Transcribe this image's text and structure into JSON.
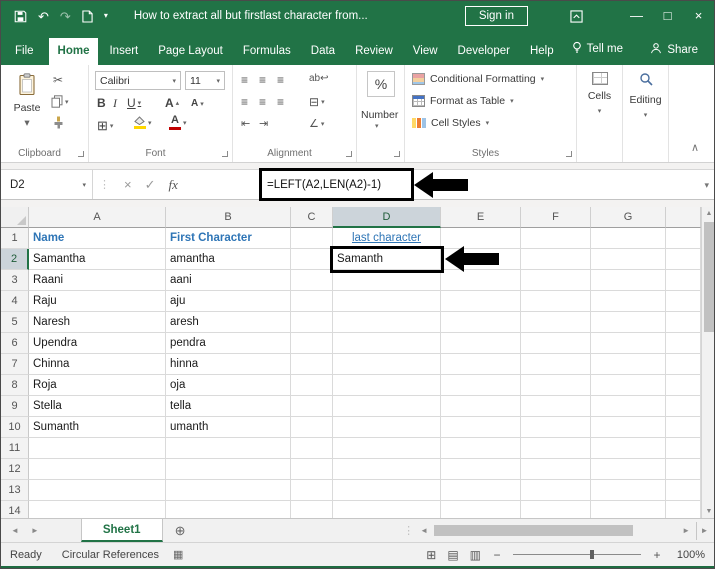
{
  "title_bar": {
    "title": "How to extract all but firstlast character from...",
    "sign_in": "Sign in"
  },
  "ribbon_tabs": [
    {
      "label": "File"
    },
    {
      "label": "Home"
    },
    {
      "label": "Insert"
    },
    {
      "label": "Page Layout"
    },
    {
      "label": "Formulas"
    },
    {
      "label": "Data"
    },
    {
      "label": "Review"
    },
    {
      "label": "View"
    },
    {
      "label": "Developer"
    },
    {
      "label": "Help"
    },
    {
      "label": "Tell me"
    }
  ],
  "share_label": "Share",
  "ribbon": {
    "paste": "Paste",
    "clipboard_group": "Clipboard",
    "font_name": "Calibri",
    "font_size": "11",
    "font_group": "Font",
    "alignment_group": "Alignment",
    "percent": "%",
    "number_dropdown": "Number",
    "conditional_formatting": "Conditional Formatting",
    "format_as_table": "Format as Table",
    "cell_styles": "Cell Styles",
    "styles_group": "Styles",
    "cells_label": "Cells",
    "editing_label": "Editing"
  },
  "formula_bar": {
    "name_box": "D2",
    "fx_label": "fx",
    "formula": "=LEFT(A2,LEN(A2)-1)"
  },
  "grid": {
    "column_headers": [
      "A",
      "B",
      "C",
      "D",
      "E",
      "F",
      "G"
    ],
    "selected_column": "D",
    "active_row": "2",
    "active_cell": "D2",
    "rows": [
      {
        "n": "1",
        "cells": {
          "A": "Name",
          "B": "First Character",
          "D": "last character"
        }
      },
      {
        "n": "2",
        "cells": {
          "A": "Samantha",
          "B": "amantha",
          "D": "Samanth"
        }
      },
      {
        "n": "3",
        "cells": {
          "A": "Raani",
          "B": "aani"
        }
      },
      {
        "n": "4",
        "cells": {
          "A": "Raju",
          "B": "aju"
        }
      },
      {
        "n": "5",
        "cells": {
          "A": "Naresh",
          "B": "aresh"
        }
      },
      {
        "n": "6",
        "cells": {
          "A": "Upendra",
          "B": "pendra"
        }
      },
      {
        "n": "7",
        "cells": {
          "A": "Chinna",
          "B": "hinna"
        }
      },
      {
        "n": "8",
        "cells": {
          "A": "Roja",
          "B": "oja"
        }
      },
      {
        "n": "9",
        "cells": {
          "A": "Stella",
          "B": "tella"
        }
      },
      {
        "n": "10",
        "cells": {
          "A": "Sumanth",
          "B": "umanth"
        }
      },
      {
        "n": "11",
        "cells": {}
      },
      {
        "n": "12",
        "cells": {}
      },
      {
        "n": "13",
        "cells": {}
      },
      {
        "n": "14",
        "cells": {}
      }
    ]
  },
  "sheet_bar": {
    "sheet_name": "Sheet1"
  },
  "status_bar": {
    "mode": "Ready",
    "info": "Circular References",
    "zoom_level": "100%"
  },
  "colors": {
    "brand_green": "#217346",
    "link_blue": "#2e75b6"
  }
}
